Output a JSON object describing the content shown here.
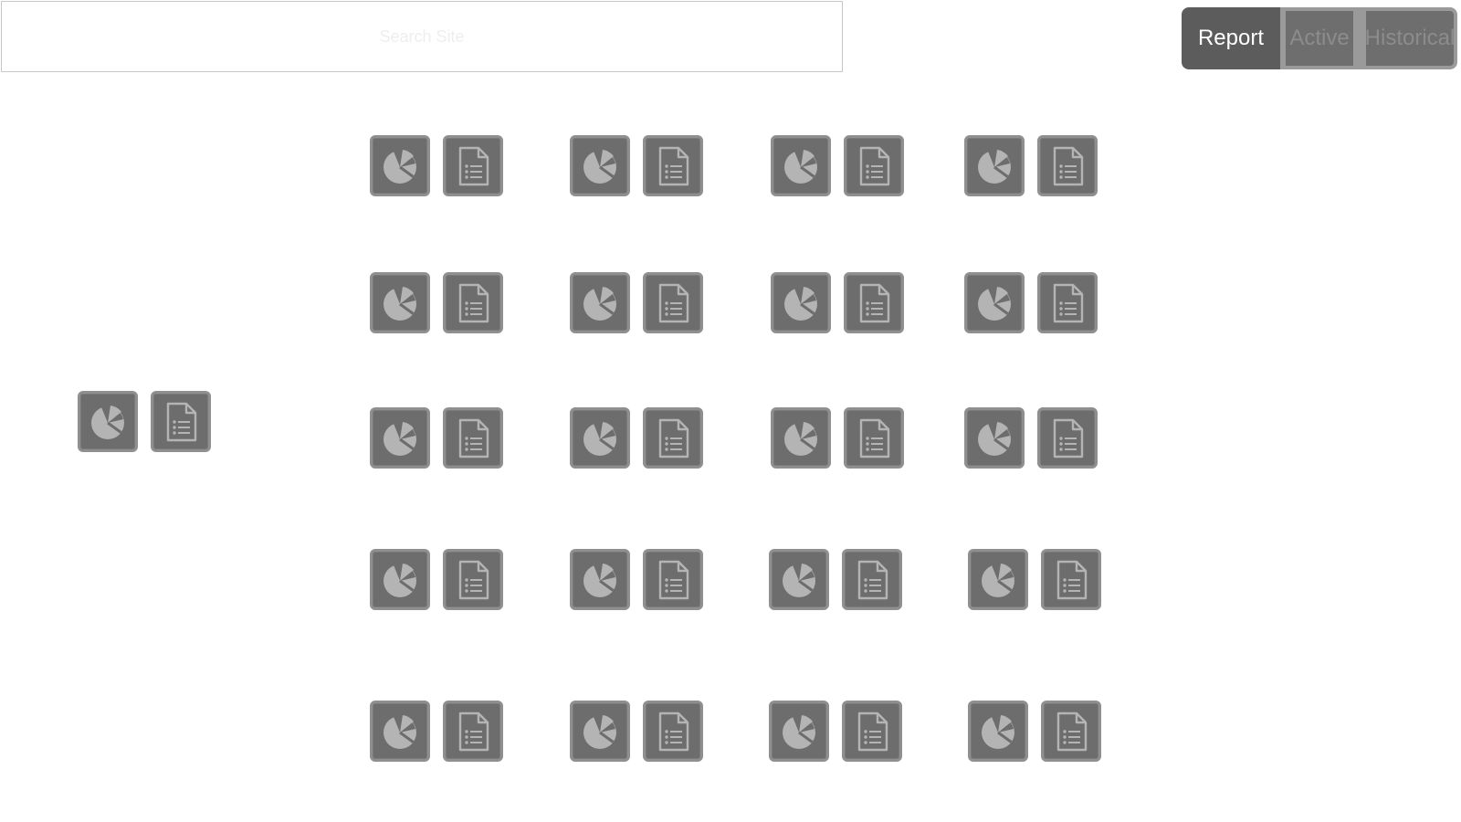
{
  "search": {
    "placeholder": "Search Site"
  },
  "mode_tabs": [
    {
      "label": "Report"
    },
    {
      "label": "Active"
    },
    {
      "label": "Historical"
    }
  ],
  "icons": {
    "chart": "pie-chart-icon",
    "report": "document-list-icon"
  },
  "colors": {
    "tile_fill": "#6d6d6d",
    "tile_border": "#8f8f8f",
    "icon_glyph": "#b4b4b4",
    "tab_selected": "#5c5c5c",
    "tab_unselected": "#6e6e6e"
  }
}
